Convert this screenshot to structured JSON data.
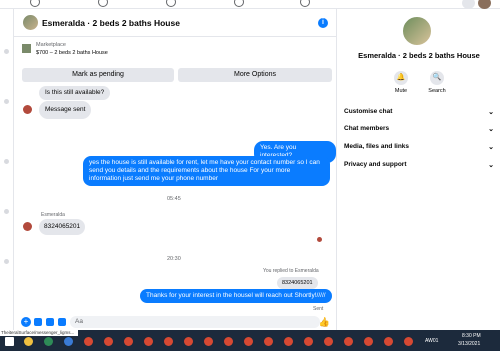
{
  "chat": {
    "title": "Esmeralda · 2 beds 2 baths House",
    "info_icon": "i",
    "marketplace_label": "Marketplace",
    "listing": "$700 – 2 beds 2 baths House",
    "mark_pending": "Mark as pending",
    "more_options": "More Options",
    "messages": {
      "m1": "Is this still available?",
      "m2": "Message sent",
      "m3": "Yes. Are you interested?",
      "m4": "yes the house is still available for rent, let me have your contact number so I can send you details and the requirements about the house For  your  more  information  just  send  me  your  phone  number",
      "ts1": "05:45",
      "sender": "Esmeralda",
      "m5": "8324065201",
      "ts2": "20:30",
      "reply_note": "You replied to Esmeralda",
      "quoted": "8324065201",
      "m6": "Thanks for your interest in the housel will reach out Shortly!/////",
      "sent": "Sent"
    },
    "composer_placeholder": "Aa"
  },
  "panel": {
    "name": "Esmeralda · 2 beds 2 baths House",
    "mute": "Mute",
    "search": "Search",
    "sections": [
      "Customise chat",
      "Chat members",
      "Media, files and links",
      "Privacy and support"
    ]
  },
  "status_url": "TheiteralSurface/messenger_ligms...",
  "taskbar": {
    "aw": "AW01",
    "time": "8:30 PM",
    "date": "3/13/2021"
  }
}
